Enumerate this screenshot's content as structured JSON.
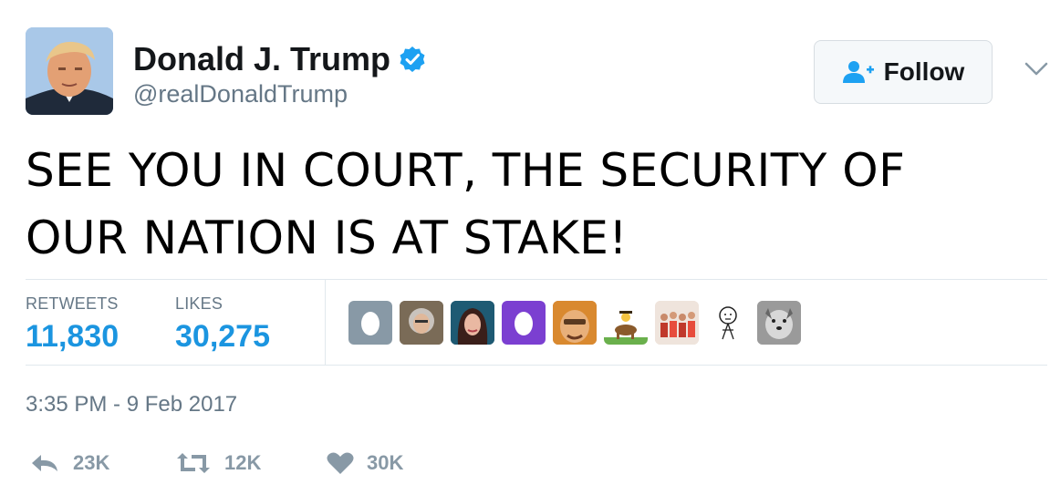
{
  "user": {
    "name": "Donald J. Trump",
    "handle": "@realDonaldTrump"
  },
  "follow": {
    "label": "Follow"
  },
  "tweet": {
    "line1": "SEE YOU IN COURT, THE SECURITY OF",
    "line2": "OUR NATION IS AT STAKE!"
  },
  "stats": {
    "retweets_label": "RETWEETS",
    "retweets_value": "11,830",
    "likes_label": "LIKES",
    "likes_value": "30,275"
  },
  "timestamp": "3:35 PM - 9 Feb 2017",
  "actions": {
    "reply_count": "23K",
    "retweet_count": "12K",
    "like_count": "30K"
  },
  "colors": {
    "link_blue": "#1b95e0",
    "verified_blue": "#1da1f2",
    "muted_gray": "#657786",
    "icon_gray": "#8899a6"
  }
}
